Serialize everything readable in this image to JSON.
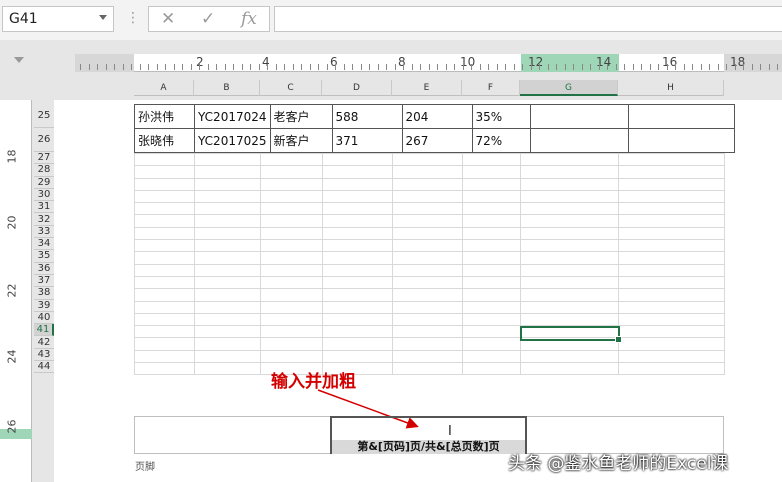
{
  "namebox": {
    "value": "G41"
  },
  "formula": {
    "value": ""
  },
  "ruler": {
    "labels": [
      "2",
      "4",
      "6",
      "8",
      "10",
      "12",
      "14",
      "16",
      "18"
    ]
  },
  "columns": [
    "A",
    "B",
    "C",
    "D",
    "E",
    "F",
    "G",
    "H"
  ],
  "vertical_ruler": [
    "18",
    "20",
    "22",
    "24",
    "26"
  ],
  "rows": [
    {
      "num": "25",
      "cells": [
        "孙洪伟",
        "YC2017024",
        "老客户",
        "588",
        "204",
        "35%",
        "",
        ""
      ]
    },
    {
      "num": "26",
      "cells": [
        "张晓伟",
        "YC2017025",
        "新客户",
        "371",
        "267",
        "72%",
        "",
        ""
      ]
    }
  ],
  "empty_rows": [
    "27",
    "28",
    "29",
    "30",
    "31",
    "32",
    "33",
    "34",
    "35",
    "36",
    "37",
    "38",
    "39",
    "40",
    "41",
    "42",
    "43",
    "44"
  ],
  "selected_row": "41",
  "footer": {
    "center_text": "第&[页码]页/共&[总页数]页",
    "label": "页脚"
  },
  "annotation": "输入并加粗",
  "watermark": "头条 @鉴水鱼老师的Excel课",
  "colors": {
    "accent": "#217346",
    "annotation": "#d40000"
  }
}
